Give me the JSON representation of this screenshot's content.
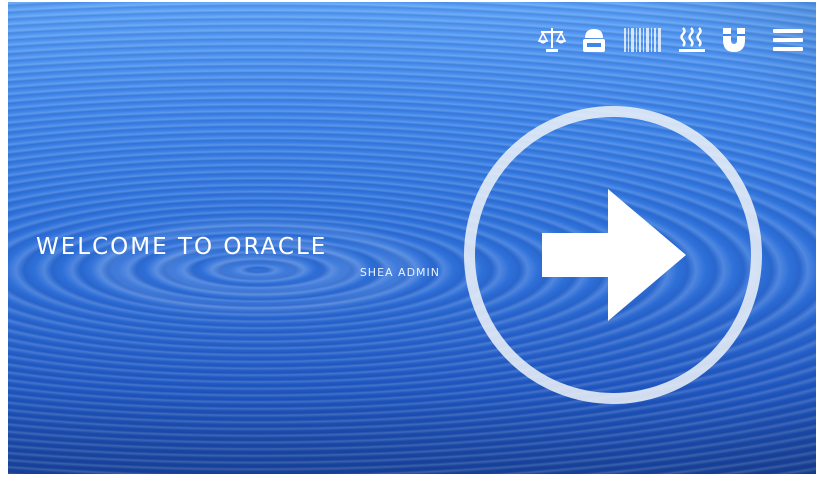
{
  "topbar": {
    "icons": [
      {
        "name": "scale-icon"
      },
      {
        "name": "printer-icon"
      },
      {
        "name": "barcode-icon"
      },
      {
        "name": "heating-icon"
      },
      {
        "name": "magnet-icon"
      },
      {
        "name": "menu-icon"
      }
    ]
  },
  "welcome": {
    "title": "WELCOME TO ORACLE",
    "subtitle": "SHEA ADMIN"
  },
  "colors": {
    "background_top": "#5aa0f6",
    "background_bottom": "#163f96",
    "foreground": "#ffffff"
  }
}
